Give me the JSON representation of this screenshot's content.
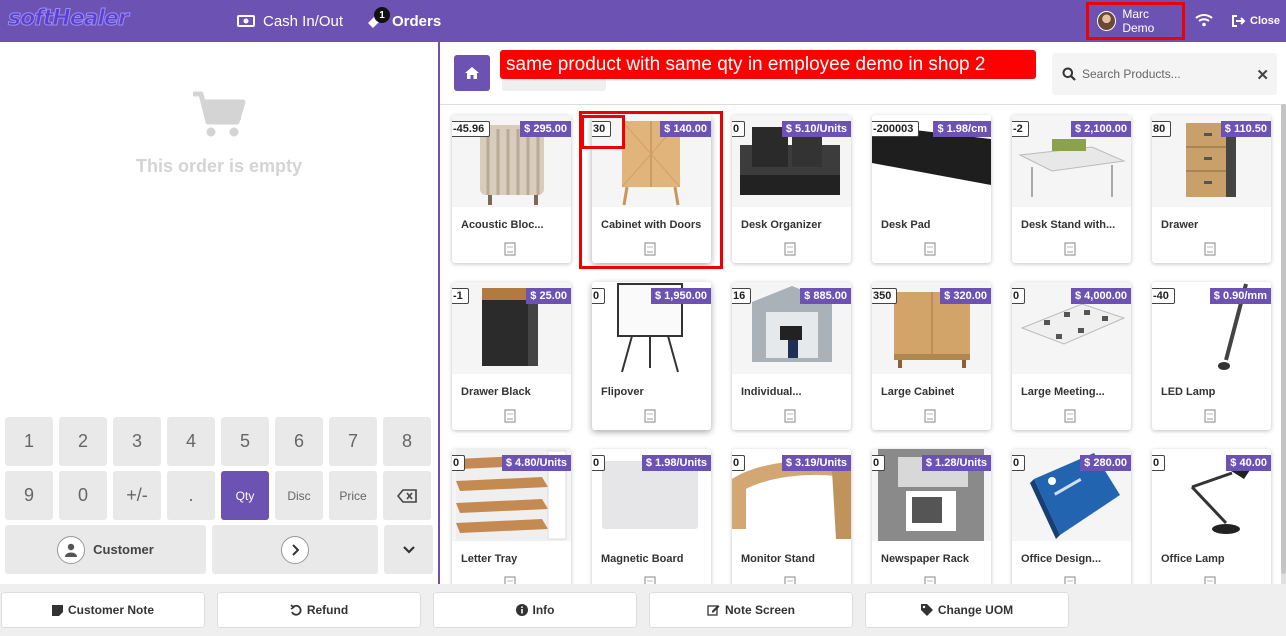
{
  "header": {
    "logo": "softHealer",
    "cash_label": "Cash In/Out",
    "orders_label": "Orders",
    "orders_badge": "1",
    "user_name": "Marc Demo",
    "close_label": "Close"
  },
  "order": {
    "empty_text": "This order is empty"
  },
  "numpad": {
    "keys": [
      "1",
      "2",
      "3",
      "4",
      "5",
      "6",
      "7",
      "8",
      "9",
      "0",
      "+/-",
      ".",
      "Qty",
      "Disc",
      "Price"
    ],
    "active_mode": "Qty",
    "customer_label": "Customer"
  },
  "products_header": {
    "annotation": "same product with same qty in  employee demo in  shop 2",
    "search_placeholder": "Search Products..."
  },
  "products": [
    {
      "qty": "-45.96",
      "price": "$ 295.00",
      "name": "Acoustic Bloc..."
    },
    {
      "qty": "30",
      "price": "$ 140.00",
      "name": "Cabinet with Doors"
    },
    {
      "qty": "0",
      "price": "$ 5.10/Units",
      "name": "Desk Organizer"
    },
    {
      "qty": "-200003",
      "price": "$ 1.98/cm",
      "name": "Desk Pad"
    },
    {
      "qty": "-2",
      "price": "$ 2,100.00",
      "name": "Desk Stand with..."
    },
    {
      "qty": "80",
      "price": "$ 110.50",
      "name": "Drawer"
    },
    {
      "qty": "-1",
      "price": "$ 25.00",
      "name": "Drawer Black"
    },
    {
      "qty": "0",
      "price": "$ 1,950.00",
      "name": "Flipover"
    },
    {
      "qty": "16",
      "price": "$ 885.00",
      "name": "Individual..."
    },
    {
      "qty": "350",
      "price": "$ 320.00",
      "name": "Large Cabinet"
    },
    {
      "qty": "0",
      "price": "$ 4,000.00",
      "name": "Large Meeting..."
    },
    {
      "qty": "-40",
      "price": "$ 0.90/mm",
      "name": "LED Lamp"
    },
    {
      "qty": "0",
      "price": "$ 4.80/Units",
      "name": "Letter Tray"
    },
    {
      "qty": "0",
      "price": "$ 1.98/Units",
      "name": "Magnetic Board"
    },
    {
      "qty": "0",
      "price": "$ 3.19/Units",
      "name": "Monitor Stand"
    },
    {
      "qty": "0",
      "price": "$ 1.28/Units",
      "name": "Newspaper Rack"
    },
    {
      "qty": "0",
      "price": "$ 280.00",
      "name": "Office Design..."
    },
    {
      "qty": "0",
      "price": "$ 40.00",
      "name": "Office Lamp"
    }
  ],
  "bottom_actions": [
    "Customer Note",
    "Refund",
    "Info",
    "Note Screen",
    "Change UOM"
  ],
  "colors": {
    "primary": "#6c52b3",
    "highlight": "#e00000"
  }
}
